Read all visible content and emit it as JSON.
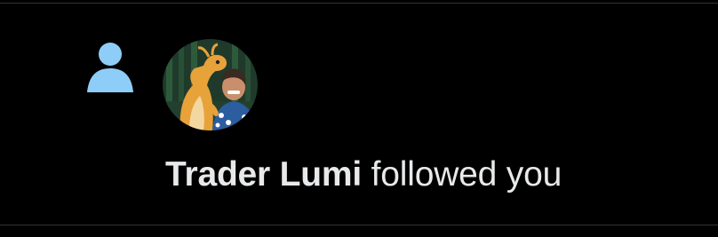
{
  "notification": {
    "type_icon": "person-icon",
    "accent_color": "#8ecdf8",
    "user_name": "Trader Lumi",
    "action_text": "followed you",
    "avatar": "user-avatar-cartoon-dragon-and-man"
  },
  "colors": {
    "background": "#000000",
    "text": "#e7e9ea",
    "divider": "#2f3336"
  }
}
